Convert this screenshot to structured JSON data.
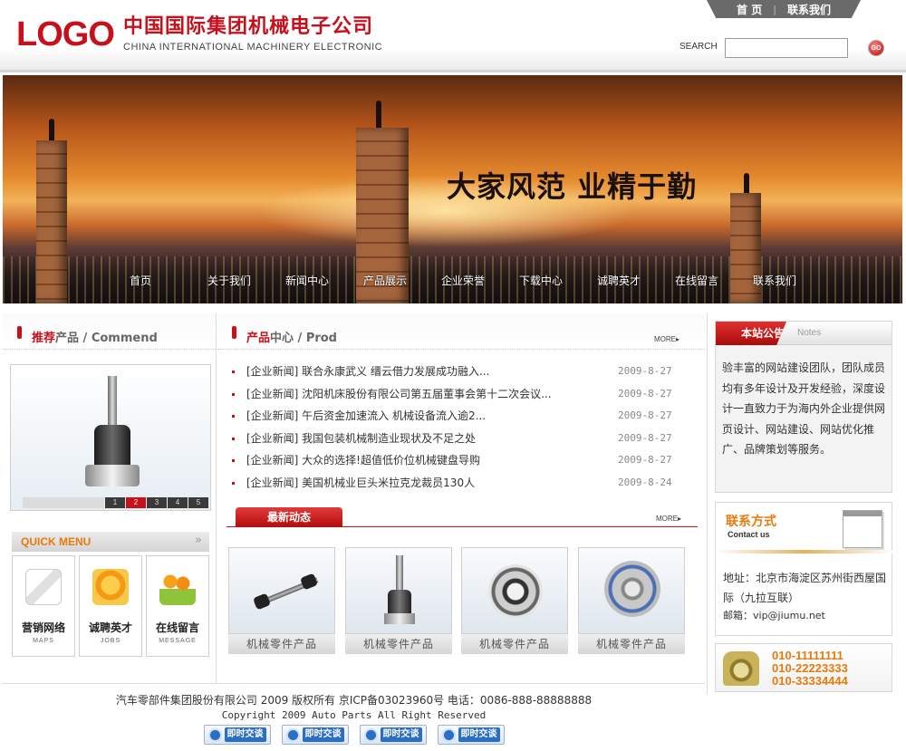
{
  "header": {
    "logo": "LOGO",
    "company_cn": "中国国际集团机械电子公司",
    "company_en": "CHINA INTERNATIONAL MACHINERY ELECTRONIC",
    "topnav": [
      "首 页",
      "联系我们"
    ],
    "search_label": "SEARCH",
    "search_value": "",
    "search_go": "GO"
  },
  "banner": {
    "slogan": "大家风范 业精于勤",
    "nav": [
      "首页",
      "关于我们",
      "新闻中心",
      "产品展示",
      "企业荣誉",
      "下载中心",
      "诚聘英才",
      "在线留言",
      "联系我们"
    ]
  },
  "recommend": {
    "title_red": "推荐",
    "title_gray": "产品 / Commend",
    "pager": [
      "1",
      "2",
      "3",
      "4",
      "5"
    ],
    "active_page": "2"
  },
  "quick_menu": {
    "title": "QUICK MENU",
    "arrow": "»",
    "items": [
      {
        "cn": "营销网络",
        "en": "MAPS",
        "icon": "document-pen-icon"
      },
      {
        "cn": "诚聘英才",
        "en": "JOBS",
        "icon": "phone-box-icon"
      },
      {
        "cn": "在线留言",
        "en": "MESSAGE",
        "icon": "people-book-icon"
      }
    ]
  },
  "products_center": {
    "title_red": "产品",
    "title_gray": "中心 / Prod",
    "more": "MORE▸",
    "news": [
      {
        "title": "[企业新闻] 联合永康武义 缙云借力发展成功融入...",
        "date": "2009-8-27"
      },
      {
        "title": "[企业新闻] 沈阳机床股份有限公司第五届董事会第十二次会议...",
        "date": "2009-8-27"
      },
      {
        "title": "[企业新闻] 午后资金加速流入 机械设备流入逾2...",
        "date": "2009-8-27"
      },
      {
        "title": "[企业新闻] 我国包装机械制造业现状及不足之处",
        "date": "2009-8-27"
      },
      {
        "title": "[企业新闻] 大众的选择!超值低价位机械键盘导购",
        "date": "2009-8-27"
      },
      {
        "title": "[企业新闻] 美国机械业巨头米拉克龙裁员130人",
        "date": "2009-8-24"
      }
    ]
  },
  "latest": {
    "tab": "最新动态",
    "more": "MORE▸",
    "products": [
      {
        "caption": "机械零件产品"
      },
      {
        "caption": "机械零件产品"
      },
      {
        "caption": "机械零件产品"
      },
      {
        "caption": "机械零件产品"
      }
    ]
  },
  "notice": {
    "title": "本站公告",
    "title_en": "Notes",
    "body": "验丰富的网站建设团队，团队成员均有多年设计及开发经验，深度设计一直致力于为海内外企业提供网页设计、网站建设、网站优化推广、品牌策划等服务。"
  },
  "contact": {
    "title": "联系方式",
    "title_en": "Contact us",
    "address": "地址：北京市海淀区苏州街西屋国际（九拉互联）",
    "email": "邮箱：vip@jiumu.net"
  },
  "phone": {
    "numbers": [
      "010-11111111",
      "010-22223333",
      "010-33334444"
    ]
  },
  "footer": {
    "line1": "汽车零部件集团股份有限公司 2009 版权所有 京ICP备03023960号 电话：0086-888-88888888",
    "line2": "Copyright 2009 Auto Parts All Right Reserved",
    "chat_label": "即时交谈",
    "chat_count": 4
  },
  "colors": {
    "brand_red": "#c8101c",
    "accent_orange": "#e87a0c"
  }
}
